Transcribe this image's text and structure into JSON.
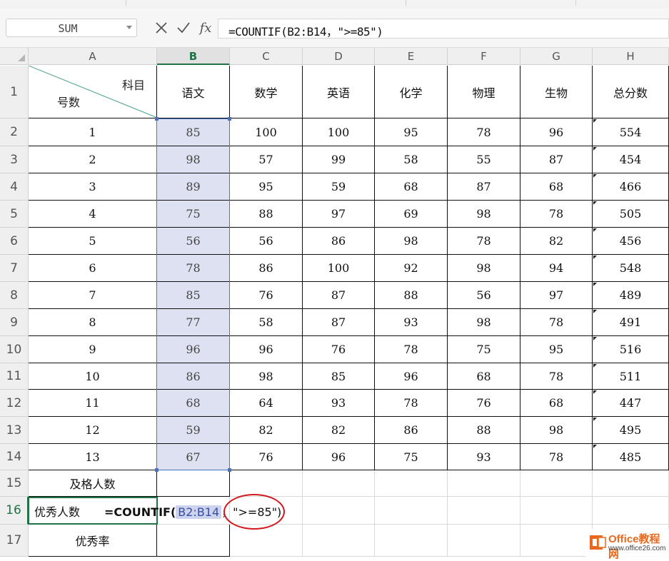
{
  "formula_bar": {
    "name_box": "SUM",
    "cancel_icon": "close-icon",
    "enter_icon": "check-icon",
    "fx_label": "fx",
    "formula": "=COUNTIF(B2:B14，\">=85\")"
  },
  "columns": [
    "A",
    "B",
    "C",
    "D",
    "E",
    "F",
    "G",
    "H"
  ],
  "rows": [
    "1",
    "2",
    "3",
    "4",
    "5",
    "6",
    "7",
    "8",
    "9",
    "10",
    "11",
    "12",
    "13",
    "14",
    "15",
    "16",
    "17"
  ],
  "header_cell": {
    "top_right": "科目",
    "bottom_left": "号数"
  },
  "subjects": [
    "语文",
    "数学",
    "英语",
    "化学",
    "物理",
    "生物",
    "总分数"
  ],
  "table": [
    {
      "id": "1",
      "scores": [
        "85",
        "100",
        "100",
        "95",
        "78",
        "96",
        "554"
      ]
    },
    {
      "id": "2",
      "scores": [
        "98",
        "57",
        "99",
        "58",
        "55",
        "87",
        "454"
      ]
    },
    {
      "id": "3",
      "scores": [
        "89",
        "95",
        "59",
        "68",
        "87",
        "68",
        "466"
      ]
    },
    {
      "id": "4",
      "scores": [
        "75",
        "88",
        "97",
        "69",
        "98",
        "78",
        "505"
      ]
    },
    {
      "id": "5",
      "scores": [
        "56",
        "56",
        "86",
        "98",
        "78",
        "82",
        "456"
      ]
    },
    {
      "id": "6",
      "scores": [
        "78",
        "86",
        "100",
        "92",
        "98",
        "94",
        "548"
      ]
    },
    {
      "id": "7",
      "scores": [
        "85",
        "76",
        "87",
        "88",
        "56",
        "97",
        "489"
      ]
    },
    {
      "id": "8",
      "scores": [
        "77",
        "58",
        "87",
        "93",
        "98",
        "78",
        "491"
      ]
    },
    {
      "id": "9",
      "scores": [
        "96",
        "96",
        "76",
        "78",
        "75",
        "95",
        "516"
      ]
    },
    {
      "id": "10",
      "scores": [
        "86",
        "98",
        "85",
        "96",
        "68",
        "78",
        "511"
      ]
    },
    {
      "id": "11",
      "scores": [
        "68",
        "64",
        "93",
        "78",
        "76",
        "68",
        "447"
      ]
    },
    {
      "id": "12",
      "scores": [
        "59",
        "82",
        "82",
        "86",
        "88",
        "98",
        "495"
      ]
    },
    {
      "id": "13",
      "scores": [
        "67",
        "76",
        "96",
        "75",
        "93",
        "78",
        "485"
      ]
    }
  ],
  "summary": {
    "pass_count_label": "及格人数",
    "excellent_count_label": "优秀人数",
    "excellent_rate_label": "优秀率"
  },
  "editing": {
    "prefix": "=COUNTIF(",
    "ref": "B2:B14",
    "suffix": "，\">=85\")"
  },
  "watermark": {
    "brand": "Office教程网",
    "url": "www.office26.com"
  },
  "colors": {
    "accent_green": "#217346",
    "selection_blue": "#4a73c2",
    "highlight_fill": "#dde1f1",
    "annotation_red": "#d0181e"
  }
}
